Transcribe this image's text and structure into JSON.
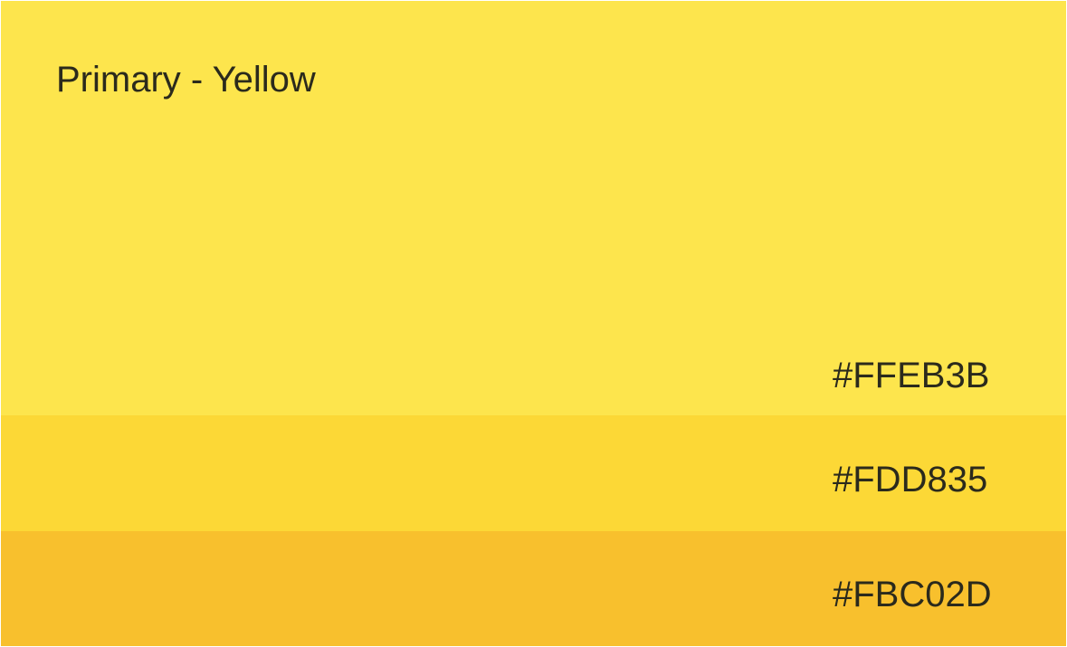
{
  "palette": {
    "title": "Primary - Yellow",
    "swatches": [
      {
        "hex": "#FFEB3B",
        "color": "#fde54d"
      },
      {
        "hex": "#FDD835",
        "color": "#fcd836"
      },
      {
        "hex": "#FBC02D",
        "color": "#f8c02d"
      }
    ]
  }
}
